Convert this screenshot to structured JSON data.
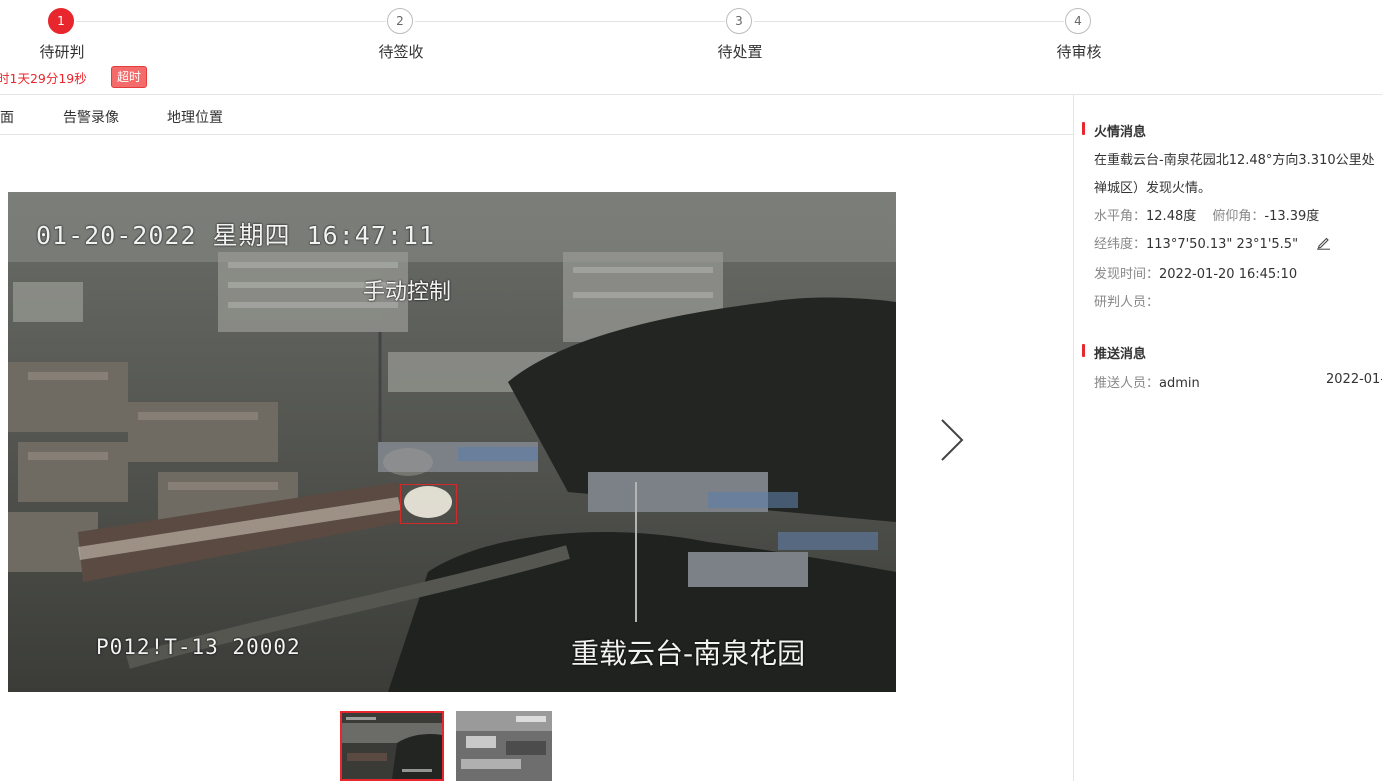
{
  "steps": [
    {
      "number": "1",
      "label": "待研判",
      "active": true
    },
    {
      "number": "2",
      "label": "待签收",
      "active": false
    },
    {
      "number": "3",
      "label": "待处置",
      "active": false
    },
    {
      "number": "4",
      "label": "待审核",
      "active": false
    }
  ],
  "timer_text": "时1天29分19秒",
  "overtime_badge": "超时",
  "tabs": [
    "面",
    "告警录像",
    "地理位置"
  ],
  "image_overlay": {
    "datetime": "01-20-2022 星期四 16:47:11",
    "mode": "手动控制",
    "camera_code": "P012!T-13  20002",
    "site_name": "重载云台-南泉花园"
  },
  "fire_info": {
    "title": "火情消息",
    "description_line1": "在重载云台-南泉花园北12.48°方向3.310公里处",
    "description_line2": "禅城区）发现火情。",
    "horizontal_label": "水平角：",
    "horizontal_value": "12.48度",
    "pitch_label": "俯仰角：",
    "pitch_value": "-13.39度",
    "coord_label": "经纬度：",
    "coord_value": "113°7'50.13\" 23°1'5.5\"",
    "found_label": "发现时间：",
    "found_value": "2022-01-20 16:45:10",
    "analyst_label": "研判人员：",
    "analyst_value": ""
  },
  "push_info": {
    "title": "推送消息",
    "pusher_label": "推送人员：",
    "pusher_value": "admin",
    "push_time": "2022-01-"
  },
  "colors": {
    "accent": "#e8262d"
  },
  "icons": [
    "chevron-right-icon",
    "edit-pencil-icon"
  ]
}
